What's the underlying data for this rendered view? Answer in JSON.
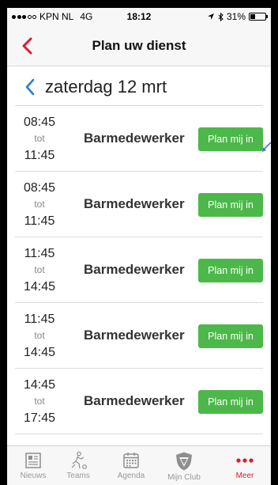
{
  "status_bar": {
    "carrier": "KPN NL",
    "network": "4G",
    "time": "18:12",
    "battery": "31%",
    "battery_level": 0.31
  },
  "nav": {
    "title": "Plan uw dienst",
    "back_icon": "chevron-left-icon",
    "accent_color": "#e3182d"
  },
  "date_header": {
    "label": "zaterdag 12 mrt",
    "prev_icon": "chevron-left-icon",
    "color": "#2a7fc1"
  },
  "shifts": [
    {
      "start": "08:45",
      "sep": "tot",
      "end": "11:45",
      "role": "Barmedewerker",
      "button": "Plan mij in"
    },
    {
      "start": "08:45",
      "sep": "tot",
      "end": "11:45",
      "role": "Barmedewerker",
      "button": "Plan mij in"
    },
    {
      "start": "11:45",
      "sep": "tot",
      "end": "14:45",
      "role": "Barmedewerker",
      "button": "Plan mij in"
    },
    {
      "start": "11:45",
      "sep": "tot",
      "end": "14:45",
      "role": "Barmedewerker",
      "button": "Plan mij in"
    },
    {
      "start": "14:45",
      "sep": "tot",
      "end": "17:45",
      "role": "Barmedewerker",
      "button": "Plan mij in"
    }
  ],
  "button_color": "#4cb849",
  "tabs": [
    {
      "label": "Nieuws",
      "icon": "newspaper-icon"
    },
    {
      "label": "Teams",
      "icon": "teams-icon"
    },
    {
      "label": "Agenda",
      "icon": "calendar-icon"
    },
    {
      "label": "Mijn Club",
      "icon": "club-shield-icon"
    },
    {
      "label": "Meer",
      "icon": "more-dots-icon",
      "active": true
    }
  ]
}
